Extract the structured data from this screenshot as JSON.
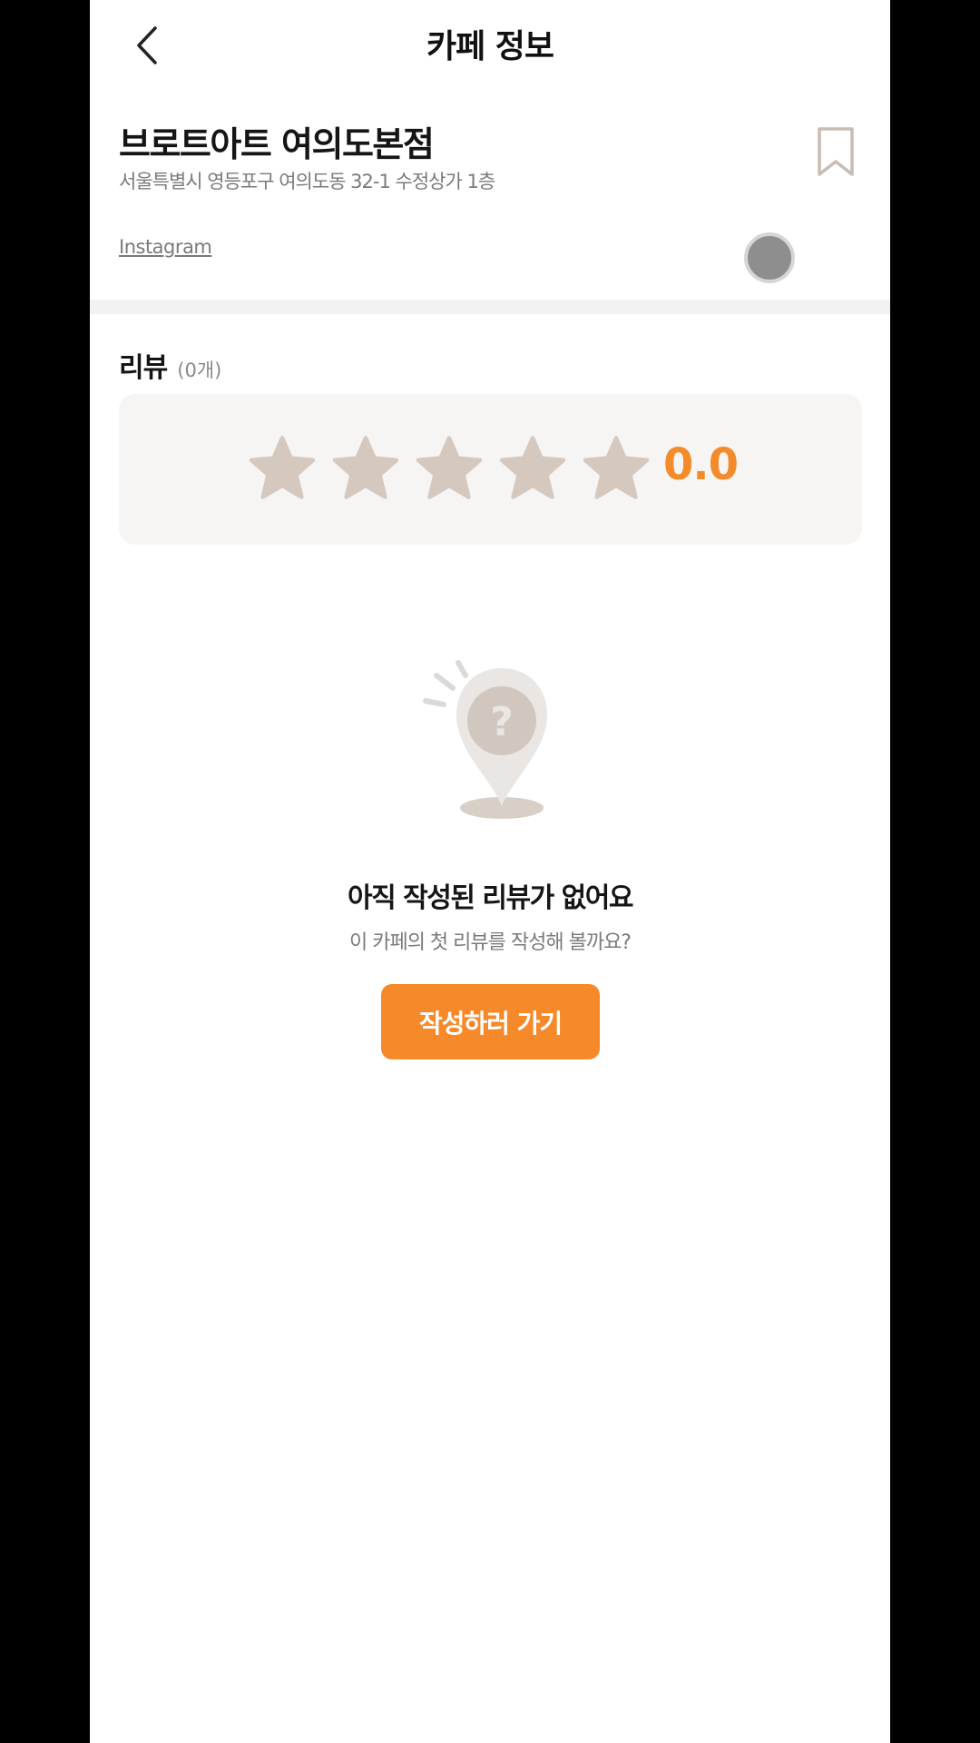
{
  "header": {
    "title": "카페 정보",
    "back_icon": "chevron-left-icon"
  },
  "cafe": {
    "name": "브로트아트 여의도본점",
    "address": "서울특별시 영등포구 여의도동 32-1 수정상가 1층",
    "instagram_label": "Instagram",
    "bookmark_icon": "bookmark-icon"
  },
  "reviews": {
    "title": "리뷰",
    "count_label": "(0개)",
    "rating": "0.0",
    "star_count": 5,
    "star_icon": "star-icon",
    "filled_stars": 0
  },
  "empty_state": {
    "illustration_icon": "question-map-pin-icon",
    "title": "아직 작성된 리뷰가 없어요",
    "subtitle": "이 카페의 첫 리뷰를 작성해 볼까요?",
    "button_label": "작성하러 가기"
  },
  "colors": {
    "accent": "#f6892a",
    "rating": "#f38b2b",
    "star_empty": "#d4c8bf",
    "card_bg": "#f7f5f3",
    "divider": "#f2f2f2"
  }
}
